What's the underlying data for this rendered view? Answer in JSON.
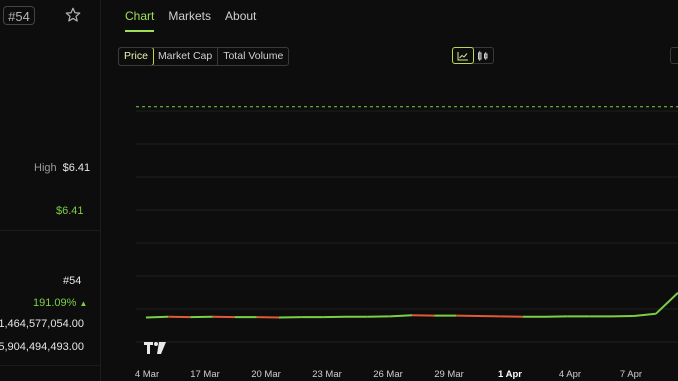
{
  "header": {
    "rank_badge": "#54"
  },
  "stats": {
    "high_label": "High",
    "high_value": "$6.41",
    "price": "$6.41",
    "rank": "#54",
    "change": "191.09%",
    "change_arrow": "▲",
    "value_1": "1,464,577,054.00",
    "value_2": "5,904,494,493.00"
  },
  "tabs": [
    {
      "label": "Chart",
      "active": true
    },
    {
      "label": "Markets",
      "active": false
    },
    {
      "label": "About",
      "active": false
    }
  ],
  "metric_buttons": [
    {
      "label": "Price",
      "active": true
    },
    {
      "label": "Market Cap",
      "active": false
    },
    {
      "label": "Total Volume",
      "active": false
    }
  ],
  "view_buttons": [
    {
      "icon": "line-chart-icon",
      "active": true
    },
    {
      "icon": "candlestick-icon",
      "active": false
    }
  ],
  "colors": {
    "accent": "#9ee05a",
    "line_up": "#7ccf45",
    "line_down": "#e05a3a",
    "high_dash": "#7ccf45"
  },
  "chart_data": {
    "type": "line",
    "x_ticks": [
      "4 Mar",
      "17 Mar",
      "20 Mar",
      "23 Mar",
      "26 Mar",
      "29 Mar",
      "1 Apr",
      "4 Apr",
      "7 Apr"
    ],
    "highlight_tick": "1 Apr",
    "high_reference": 6.41,
    "ylim": [
      0,
      7.2
    ],
    "grid": true,
    "watermark_icon": "tradingview-logo",
    "series": [
      {
        "values": [
          0.62,
          0.64,
          0.63,
          0.64,
          0.63,
          0.63,
          0.62,
          0.63,
          0.63,
          0.64,
          0.64,
          0.65,
          0.68,
          0.67,
          0.67,
          0.66,
          0.65,
          0.64,
          0.64,
          0.65,
          0.65,
          0.65,
          0.66,
          0.72,
          1.3
        ]
      }
    ]
  }
}
